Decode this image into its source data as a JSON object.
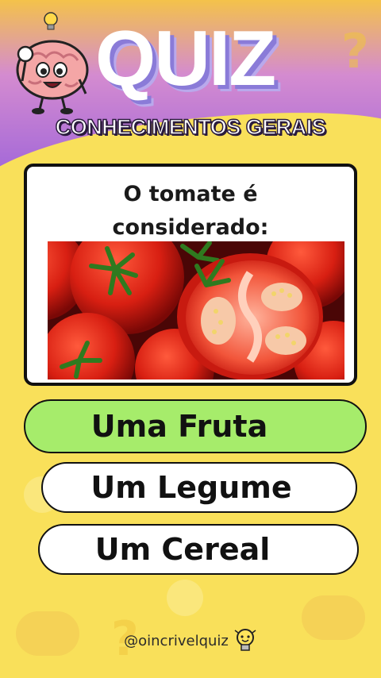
{
  "header": {
    "title": "QUIZ",
    "subtitle": "CONHECIMENTOS GERAIS"
  },
  "question": {
    "text_line1": "O tomate é",
    "text_line2": "considerado:"
  },
  "options": [
    {
      "label": "Uma Fruta",
      "state": "correct"
    },
    {
      "label": "Um Legume",
      "state": "default"
    },
    {
      "label": "Um Cereal",
      "state": "default"
    }
  ],
  "footer": {
    "handle": "@oincrivelquiz"
  },
  "colors": {
    "correct": "#a6ec6b",
    "background": "#f9e05a",
    "header_purple": "#a66ad8"
  },
  "icons": {
    "mascot": "brain-mascot-icon",
    "footer": "lightbulb-icon"
  }
}
